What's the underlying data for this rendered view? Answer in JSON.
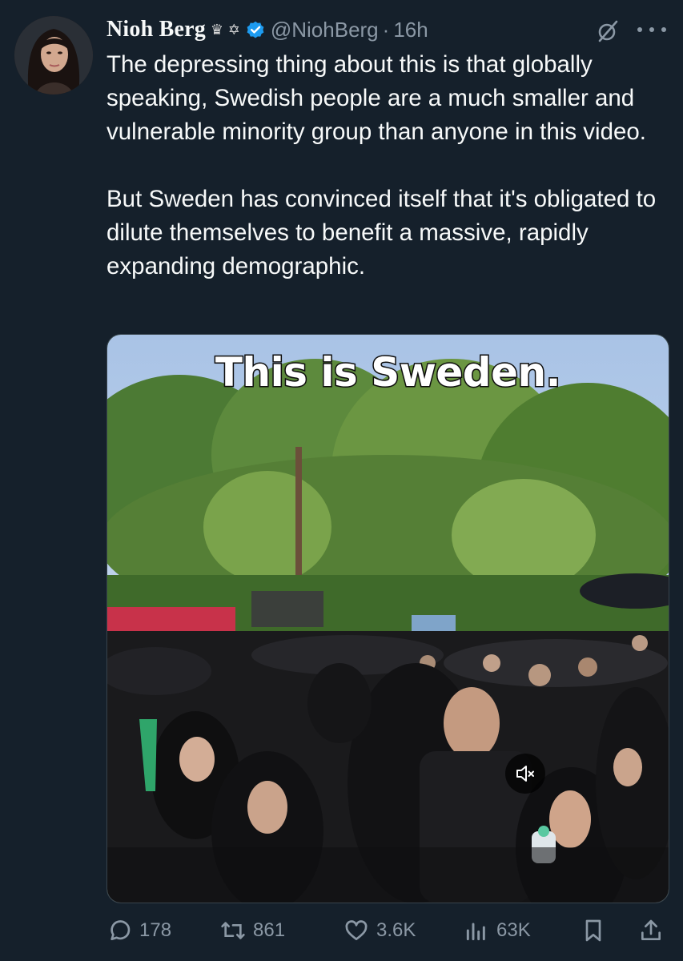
{
  "tweet": {
    "author": {
      "display_name": "Nioh Berg",
      "name_emoji": "♛ ✡",
      "verified": true,
      "handle": "@NiohBerg",
      "separator": "·",
      "time": "16h",
      "avatar_icon": "avatar"
    },
    "text": "The depressing thing about this is that globally speaking, Swedish people are a much smaller and vulnerable minority group than anyone in this video.\n\nBut Sweden has convinced itself that it's obligated to dilute themselves to benefit a massive, rapidly expanding demographic.",
    "media": {
      "caption": "This is Sweden.",
      "mute_icon": "speaker-muted-icon"
    },
    "actions": {
      "replies": "178",
      "retweets": "861",
      "likes": "3.6K",
      "views": "63K"
    }
  },
  "colors": {
    "background": "#15202b",
    "primary_text": "#f7f9f9",
    "secondary_text": "#8b98a5",
    "verified_badge": "#1d9bf0"
  },
  "icons": {
    "verified": "verified-badge-icon",
    "grok": "grok-icon",
    "more": "more-icon",
    "reply": "reply-icon",
    "retweet": "retweet-icon",
    "like": "heart-icon",
    "views": "views-icon",
    "bookmark": "bookmark-icon",
    "share": "share-icon"
  }
}
